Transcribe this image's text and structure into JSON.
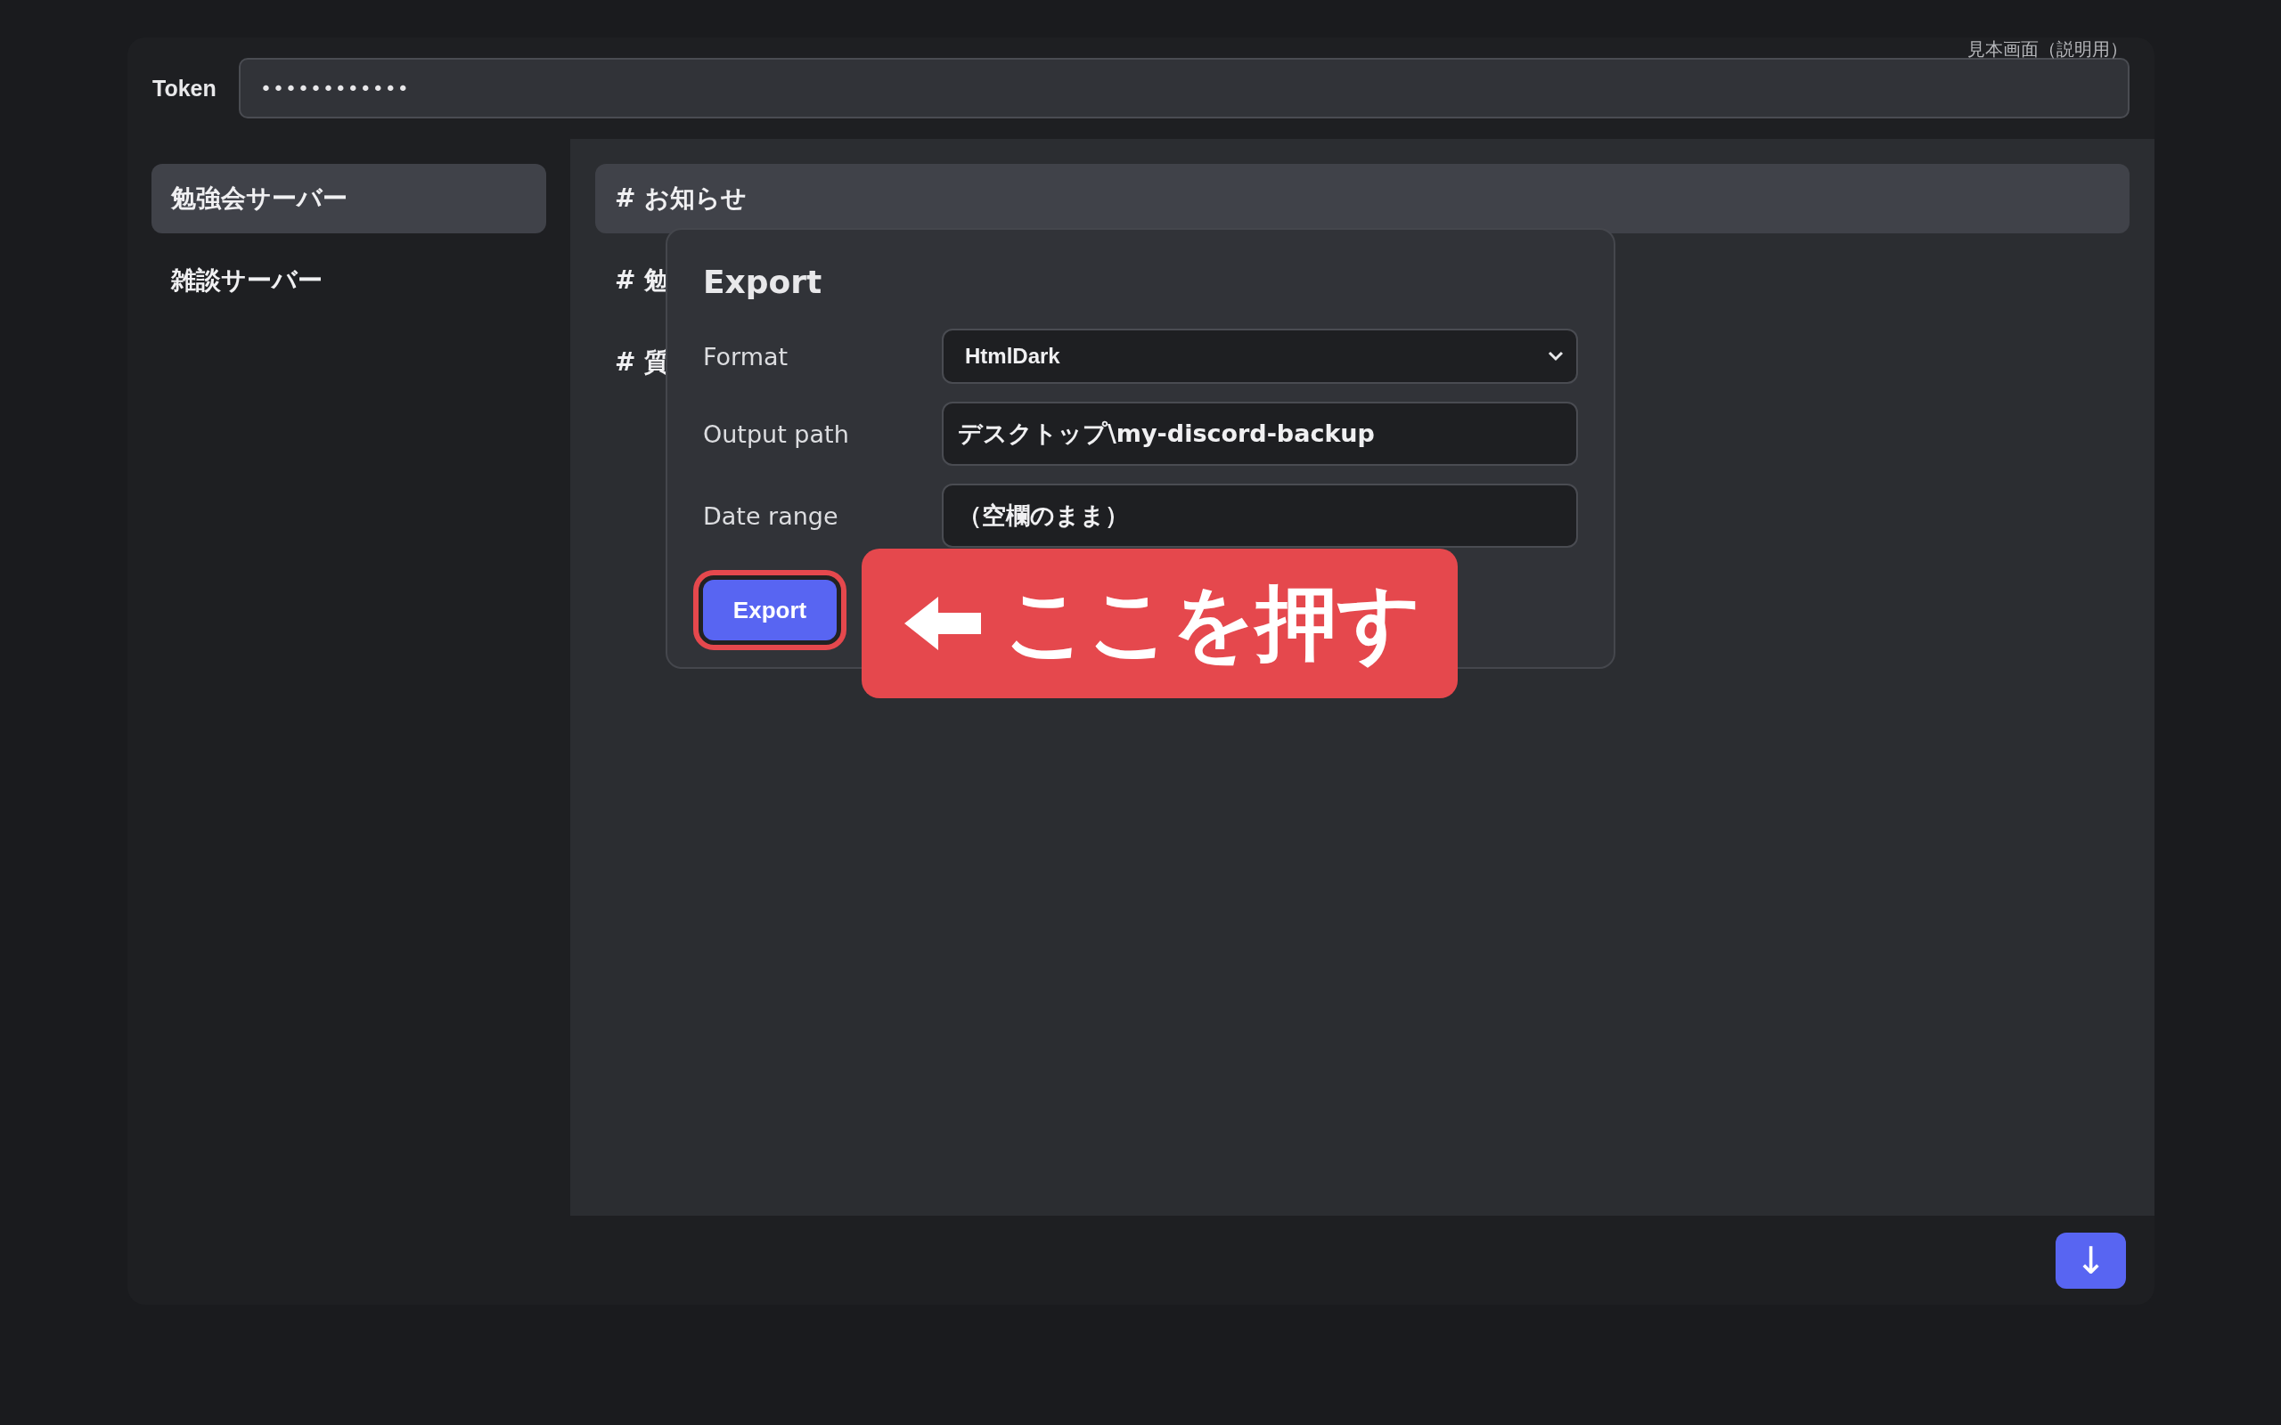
{
  "token": {
    "label": "Token",
    "value": "••••••••••••"
  },
  "note": "見本画面（説明用）",
  "servers": [
    {
      "name": "勉強会サーバー",
      "selected": true
    },
    {
      "name": "雑談サーバー",
      "selected": false
    }
  ],
  "channels": [
    {
      "name": "# お知らせ",
      "selected": true
    },
    {
      "name": "# 勉",
      "selected": false
    },
    {
      "name": "# 質",
      "selected": false
    }
  ],
  "dialog": {
    "title": "Export",
    "fields": [
      {
        "kind": "select",
        "label": "Format",
        "value": "HtmlDark"
      },
      {
        "kind": "text",
        "label": "Output path",
        "value": "デスクトップ\\my-discord-backup"
      },
      {
        "kind": "text",
        "label": "Date range",
        "value": "（空欄のまま）"
      }
    ],
    "button": {
      "label": "Export",
      "highlighted": true
    }
  },
  "callout": {
    "text": "ここを押す"
  },
  "scroll_button": {
    "label": "↓"
  }
}
